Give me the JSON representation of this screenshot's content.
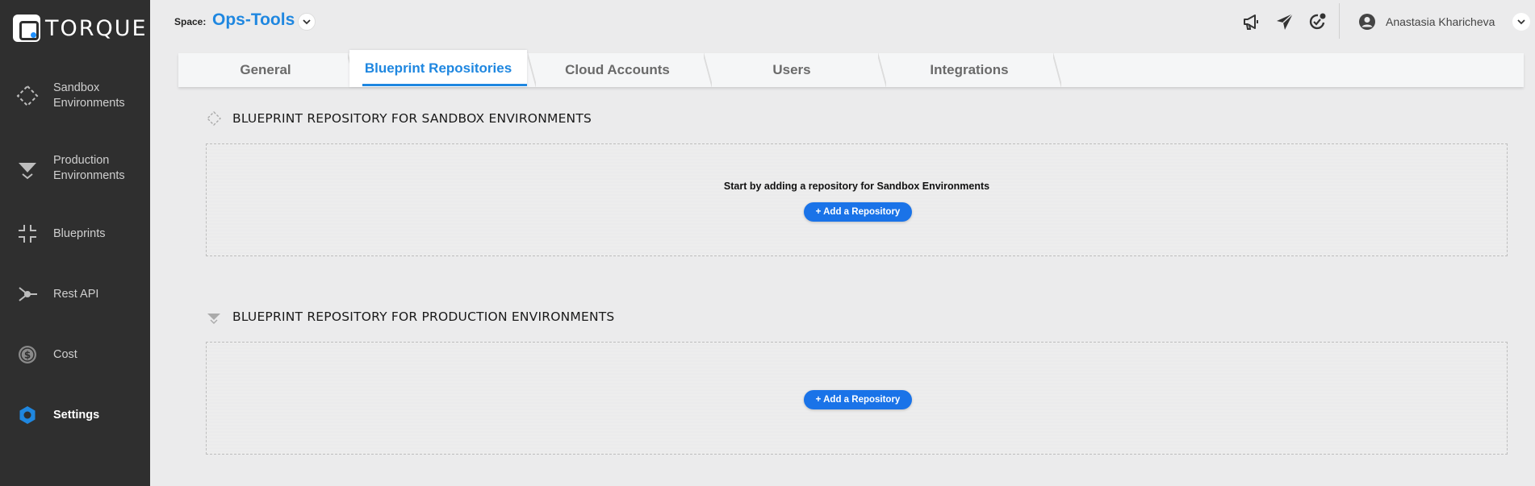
{
  "brand": {
    "logo_text": "TORQUE",
    "accent": "#1f87e0"
  },
  "sidebar": {
    "items": [
      {
        "label": "Sandbox Environments",
        "icon": "sandbox-icon"
      },
      {
        "label": "Production Environments",
        "icon": "production-icon"
      },
      {
        "label": "Blueprints",
        "icon": "blueprints-icon"
      },
      {
        "label": "Rest API",
        "icon": "rest-api-icon"
      },
      {
        "label": "Cost",
        "icon": "cost-icon"
      },
      {
        "label": "Settings",
        "icon": "settings-icon",
        "active": true
      }
    ]
  },
  "topbar": {
    "space_label": "Space:",
    "space_name": "Ops-Tools",
    "icons": [
      "announcements-icon",
      "send-icon",
      "notifications-icon"
    ],
    "user_name": "Anastasia Kharicheva"
  },
  "tabs": [
    {
      "label": "General"
    },
    {
      "label": "Blueprint Repositories",
      "active": true
    },
    {
      "label": "Cloud Accounts"
    },
    {
      "label": "Users"
    },
    {
      "label": "Integrations"
    }
  ],
  "sections": {
    "sandbox": {
      "title": "BLUEPRINT REPOSITORY FOR SANDBOX ENVIRONMENTS",
      "message": "Start by adding a repository for Sandbox Environments",
      "button": "+ Add a Repository"
    },
    "production": {
      "title": "BLUEPRINT REPOSITORY FOR PRODUCTION ENVIRONMENTS",
      "button": "+ Add a Repository"
    }
  }
}
